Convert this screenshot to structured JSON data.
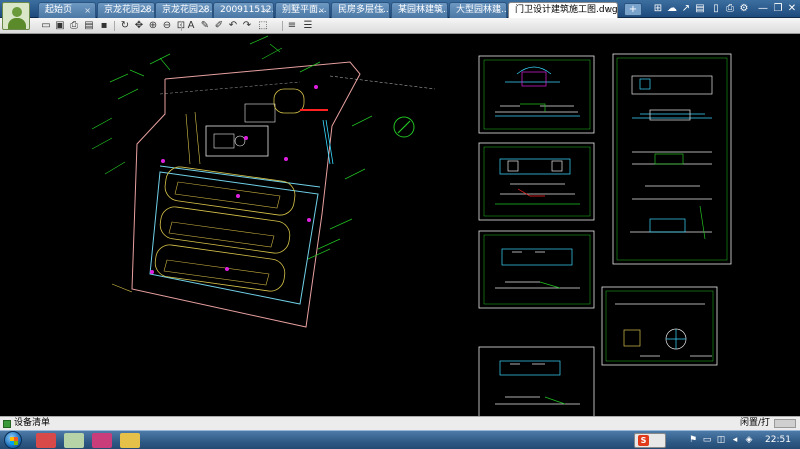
{
  "tabs": [
    {
      "label": "起始页",
      "active": false
    },
    {
      "label": "京龙花园28...",
      "active": false
    },
    {
      "label": "京龙花园28...",
      "active": false
    },
    {
      "label": "200911512...",
      "active": false
    },
    {
      "label": "别墅平面...",
      "active": false
    },
    {
      "label": "民房多层住...",
      "active": false
    },
    {
      "label": "某园林建筑...",
      "active": false
    },
    {
      "label": "大型园林建...",
      "active": false
    },
    {
      "label": "门卫设计建筑施工图.dwg",
      "active": true
    }
  ],
  "new_tab_label": "+",
  "system_icons": [
    "grid-icon",
    "cloud-icon",
    "share-icon",
    "folder-icon",
    "mobile-icon",
    "print-icon",
    "star-icon",
    "settings-icon",
    "minimize-icon",
    "close-icon"
  ],
  "toolbar_icons": [
    "open-icon",
    "save-icon",
    "print-icon",
    "print-preview-icon",
    "lock-icon",
    "rotate-icon",
    "pan-icon",
    "zoom-in-icon",
    "zoom-out-icon",
    "zoom-extents-icon",
    "text-icon",
    "pen-icon",
    "brush-icon",
    "undo-icon",
    "redo-icon",
    "fit-icon",
    "layers-icon",
    "layer-stack-icon"
  ],
  "status": {
    "label": "设备清单",
    "right_text": "闲置/打"
  },
  "taskbar": {
    "clock": "22:51",
    "tray_badge": "S"
  },
  "colors": {
    "canvas": "#000000",
    "cad_green": "#22c322",
    "cad_cyan": "#38d8ff",
    "cad_magenta": "#e020e0",
    "cad_yellow": "#d8c44a",
    "cad_white": "#e8e8e8",
    "cad_red": "#ff2020"
  }
}
